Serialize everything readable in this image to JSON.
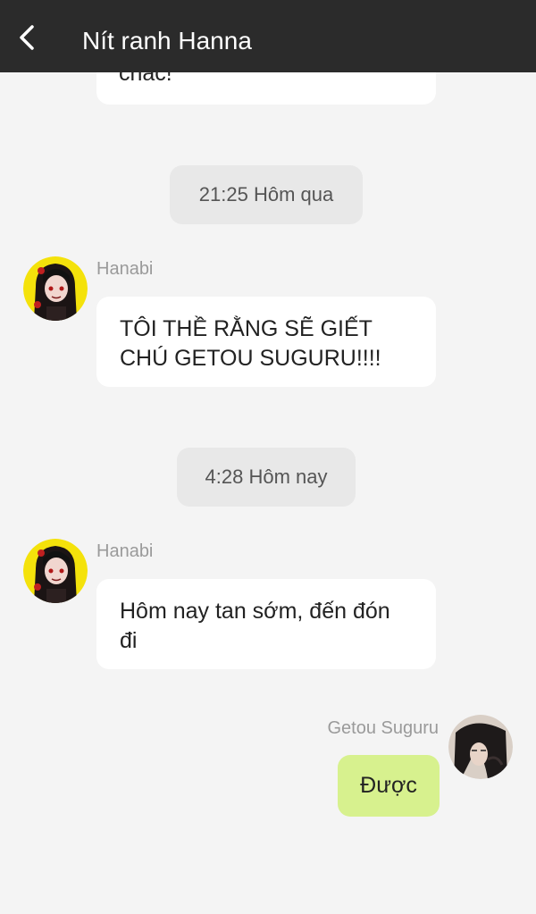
{
  "header": {
    "title": "Nít ranh Hanna",
    "back_icon": "chevron-left-icon"
  },
  "earlier_message": {
    "text": "chắc!"
  },
  "conversation": [
    {
      "type": "time",
      "label": "21:25 Hôm qua"
    },
    {
      "type": "incoming",
      "sender": "Hanabi",
      "text": "TÔI THỀ RẰNG SẼ GIẾT CHÚ GETOU SUGURU!!!!"
    },
    {
      "type": "time",
      "label": "4:28 Hôm nay"
    },
    {
      "type": "incoming",
      "sender": "Hanabi",
      "text": "Hôm nay tan sớm, đến đón đi"
    },
    {
      "type": "outgoing",
      "sender": "Getou Suguru",
      "text": "Được"
    }
  ],
  "colors": {
    "header_bg": "#2b2b2b",
    "page_bg": "#f4f4f4",
    "bubble_in": "#ffffff",
    "bubble_out": "#d7f18e",
    "time_pill": "#e8e8e8",
    "sender_name": "#9a9a9a",
    "hanabi_avatar_bg": "#f4e20b"
  }
}
